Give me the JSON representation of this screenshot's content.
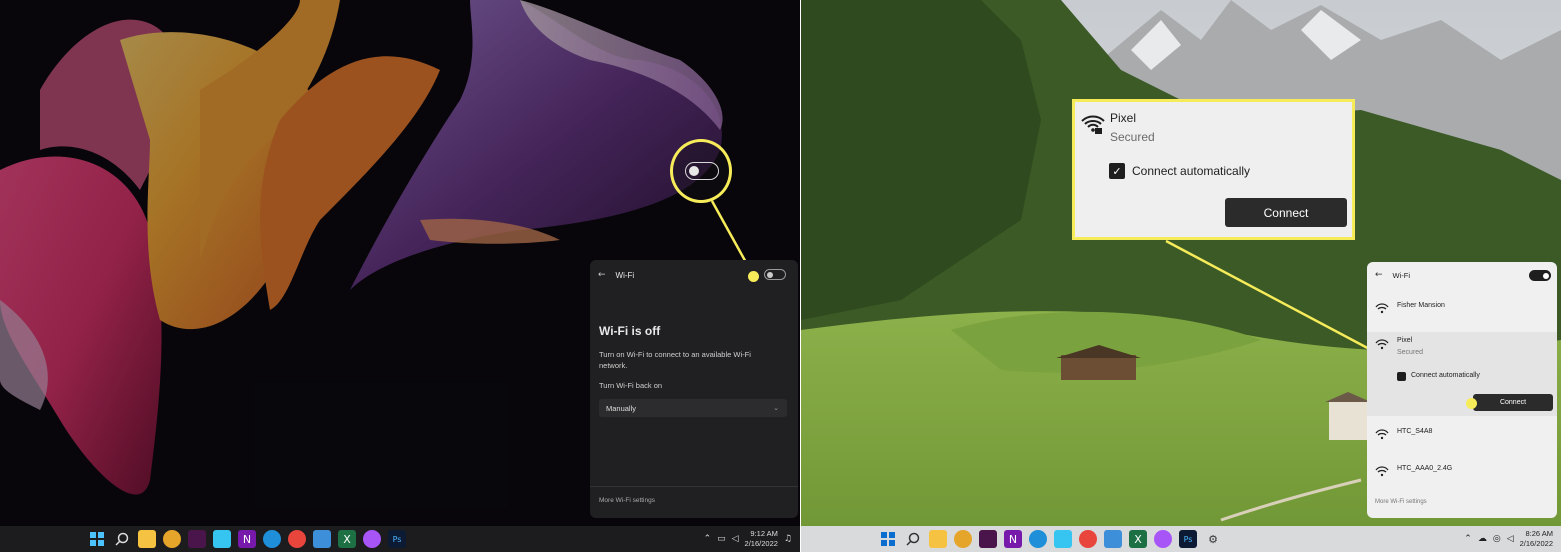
{
  "left": {
    "wifi_panel": {
      "header_title": "Wi-Fi",
      "title": "Wi-Fi is off",
      "description": "Turn on Wi-Fi to connect to an available Wi-Fi network.",
      "turn_back_label": "Turn Wi-Fi back on",
      "select_value": "Manually",
      "more_settings": "More Wi-Fi settings",
      "toggle_state": "off"
    },
    "taskbar": {
      "icons": [
        "windows-start-icon",
        "search-icon",
        "file-explorer-icon",
        "chrome-canary-icon",
        "slack-icon",
        "slack-icon-2",
        "onenote-icon",
        "edge-icon",
        "chrome-icon",
        "notepad-icon",
        "excel-icon",
        "messenger-icon",
        "photoshop-icon"
      ],
      "time": "9:12 AM",
      "date": "2/16/2022"
    }
  },
  "right": {
    "callout": {
      "network_name": "Pixel",
      "network_status": "Secured",
      "auto_connect_label": "Connect automatically",
      "connect_label": "Connect"
    },
    "wifi_panel": {
      "header_title": "Wi-Fi",
      "toggle_state": "on",
      "networks": [
        {
          "name": "Fisher Mansion"
        },
        {
          "name": "Pixel",
          "status": "Secured",
          "auto_connect": "Connect automatically",
          "connect": "Connect"
        },
        {
          "name": "HTC_S4A8"
        },
        {
          "name": "HTC_AAA0_2.4G"
        }
      ],
      "more_settings": "More Wi-Fi settings"
    },
    "taskbar": {
      "time": "8:26 AM",
      "date": "2/16/2022"
    }
  },
  "colors": {
    "highlight": "#f6ec5a",
    "dark_panel": "#202022",
    "light_panel": "#f0f0f0"
  }
}
